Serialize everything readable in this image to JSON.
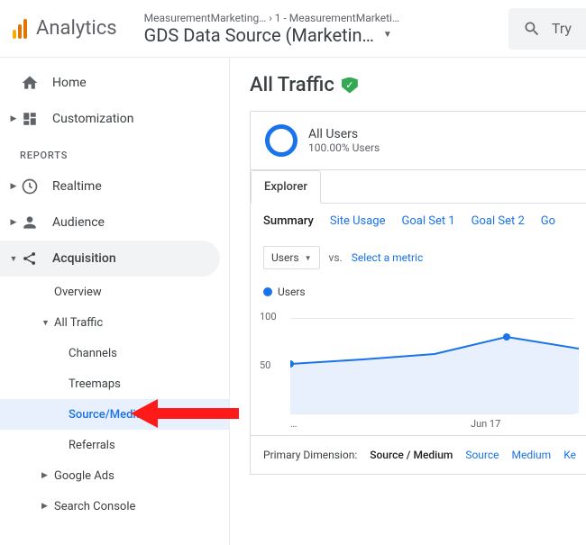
{
  "header": {
    "product": "Analytics",
    "breadcrumb_top": "MeasurementMarketing… › 1 - MeasurementMarketi…",
    "breadcrumb_title": "GDS Data Source (Marketin…",
    "search_placeholder": "Try"
  },
  "sidebar": {
    "home": "Home",
    "customization": "Customization",
    "reports_label": "REPORTS",
    "realtime": "Realtime",
    "audience": "Audience",
    "acquisition": "Acquisition",
    "overview": "Overview",
    "all_traffic": "All Traffic",
    "channels": "Channels",
    "treemaps": "Treemaps",
    "source_medium": "Source/Medium",
    "referrals": "Referrals",
    "google_ads": "Google Ads",
    "search_console": "Search Console"
  },
  "main": {
    "title": "All Traffic",
    "segment_name": "All Users",
    "segment_sub": "100.00% Users",
    "explorer_tab": "Explorer",
    "subtabs": [
      "Summary",
      "Site Usage",
      "Goal Set 1",
      "Goal Set 2",
      "Go"
    ],
    "metric_dropdown": "Users",
    "vs": "vs.",
    "select_metric": "Select a metric",
    "legend": "Users",
    "primary_dimension_label": "Primary Dimension:",
    "primary_dimensions": [
      "Source / Medium",
      "Source",
      "Medium",
      "Ke"
    ]
  },
  "chart_data": {
    "type": "line",
    "title": "",
    "xlabel": "",
    "ylabel": "",
    "ylim": [
      0,
      120
    ],
    "y_ticks": [
      50,
      100
    ],
    "x_ticks": [
      "…",
      "Jun 17"
    ],
    "series": [
      {
        "name": "Users",
        "color": "#1a73e8",
        "values": [
          60,
          65,
          72,
          92,
          78
        ]
      }
    ]
  }
}
